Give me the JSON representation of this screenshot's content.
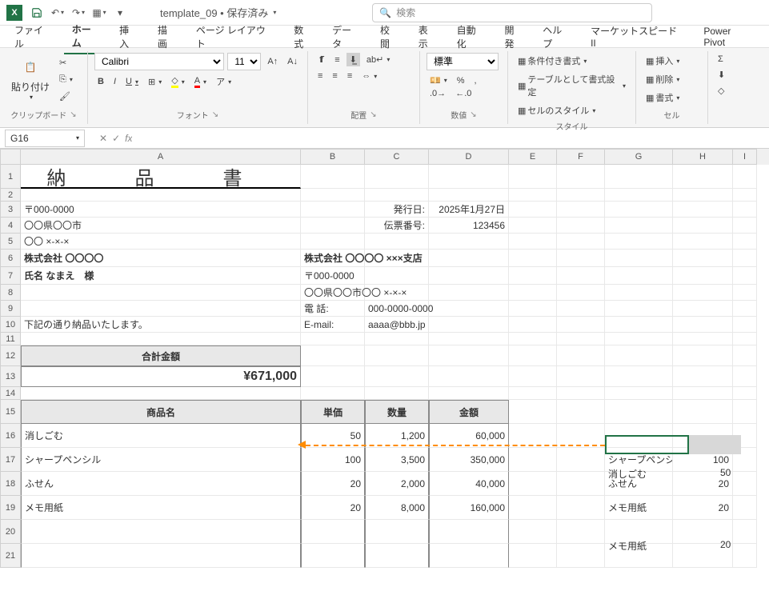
{
  "titlebar": {
    "doc_name": "template_09 • 保存済み",
    "search_placeholder": "検索"
  },
  "menu": {
    "tabs": [
      "ファイル",
      "ホーム",
      "挿入",
      "描画",
      "ページ レイアウト",
      "数式",
      "データ",
      "校閲",
      "表示",
      "自動化",
      "開発",
      "ヘルプ",
      "マーケットスピード II",
      "Power Pivot"
    ],
    "active_index": 1
  },
  "ribbon": {
    "clipboard": {
      "paste": "貼り付け",
      "label": "クリップボード"
    },
    "font": {
      "name": "Calibri",
      "size": "11",
      "bold": "B",
      "italic": "I",
      "underline": "U",
      "label": "フォント"
    },
    "align": {
      "label": "配置"
    },
    "number": {
      "format": "標準",
      "label": "数値"
    },
    "styles": {
      "cond": "条件付き書式",
      "table": "テーブルとして書式設定",
      "cell": "セルのスタイル",
      "label": "スタイル"
    },
    "cells": {
      "insert": "挿入",
      "delete": "削除",
      "format": "書式",
      "label": "セル"
    }
  },
  "namebox": "G16",
  "sheet": {
    "title": "納 品 書",
    "postal": "〒000-0000",
    "addr1": "〇〇県〇〇市",
    "addr2": "〇〇 ×-×-×",
    "company_to": "株式会社 〇〇〇〇",
    "person_to": "氏名 なまえ　様",
    "issue_label": "発行日:",
    "issue_date": "2025年1月27日",
    "slip_label": "伝票番号:",
    "slip_no": "123456",
    "company_from": "株式会社 〇〇〇〇 ×××支店",
    "from_postal": "〒000-0000",
    "from_addr": "〇〇県〇〇市〇〇 ×-×-×",
    "tel_label": "電 話:",
    "tel": "000-0000-0000",
    "email_label": "E-mail:",
    "email": "aaaa@bbb.jp",
    "note": "下記の通り納品いたします。",
    "total_label": "合計金額",
    "total_value": "¥671,000",
    "th_name": "商品名",
    "th_price": "単価",
    "th_qty": "数量",
    "th_amt": "金額",
    "rows": [
      {
        "name": "消しごむ",
        "price": "50",
        "qty": "1,200",
        "amt": "60,000"
      },
      {
        "name": "シャープペンシル",
        "price": "100",
        "qty": "3,500",
        "amt": "350,000"
      },
      {
        "name": "ふせん",
        "price": "20",
        "qty": "2,000",
        "amt": "40,000"
      },
      {
        "name": "メモ用紙",
        "price": "20",
        "qty": "8,000",
        "amt": "160,000"
      }
    ]
  },
  "side_list": [
    {
      "name": "消しごむ",
      "val": "50"
    },
    {
      "name": "シャープペンシル",
      "val": "100"
    },
    {
      "name": "ふせん",
      "val": "20"
    },
    {
      "name": "メモ用紙",
      "val": "20"
    }
  ],
  "fx": "fx"
}
